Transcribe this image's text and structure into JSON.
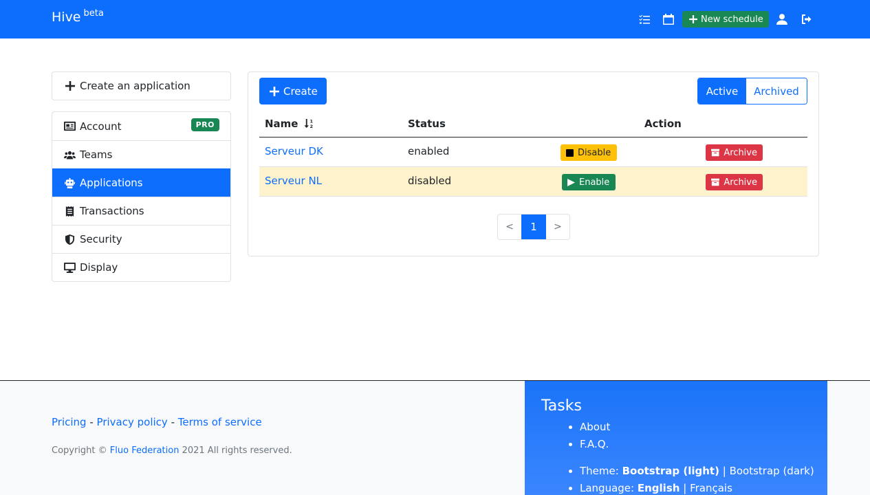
{
  "navbar": {
    "brand": "Hive",
    "brand_sup": "beta",
    "new_schedule": "New schedule"
  },
  "sidebar": {
    "create_app": "Create an application",
    "items": [
      {
        "label": "Account",
        "icon": "id-card-icon",
        "badge": "PRO"
      },
      {
        "label": "Teams",
        "icon": "users-icon"
      },
      {
        "label": "Applications",
        "icon": "robot-icon",
        "active": true
      },
      {
        "label": "Transactions",
        "icon": "receipt-icon"
      },
      {
        "label": "Security",
        "icon": "shield-icon"
      },
      {
        "label": "Display",
        "icon": "monitor-icon"
      }
    ]
  },
  "main": {
    "create_label": "Create",
    "filter": {
      "active": "Active",
      "archived": "Archived"
    },
    "columns": {
      "name": "Name",
      "status": "Status",
      "action": "Action"
    },
    "rows": [
      {
        "name": "Serveur DK",
        "status": "enabled",
        "toggle": "Disable",
        "archive": "Archive"
      },
      {
        "name": "Serveur NL",
        "status": "disabled",
        "toggle": "Enable",
        "archive": "Archive"
      }
    ],
    "pager": {
      "prev": "<",
      "current": "1",
      "next": ">"
    }
  },
  "footer": {
    "links": {
      "pricing": "Pricing",
      "privacy": "Privacy policy",
      "terms": "Terms of service",
      "sep": "-"
    },
    "copyright_prefix": "Copyright ©",
    "copyright_org": "Fluo Federation",
    "copyright_suffix": "2021 All rights reserved.",
    "tasks": {
      "title": "Tasks",
      "items": [
        "About",
        "F.A.Q."
      ],
      "theme_label": "Theme:",
      "theme_current": "Bootstrap (light)",
      "theme_sep": "|",
      "theme_alt": "Bootstrap (dark)",
      "lang_label": "Language:",
      "lang_current": "English",
      "lang_sep": "|",
      "lang_alt": "Français"
    }
  },
  "colors": {
    "primary": "#0d6efd",
    "success": "#198754",
    "warning": "#ffc107",
    "danger": "#dc3545",
    "row_warning": "#fff3cd"
  }
}
